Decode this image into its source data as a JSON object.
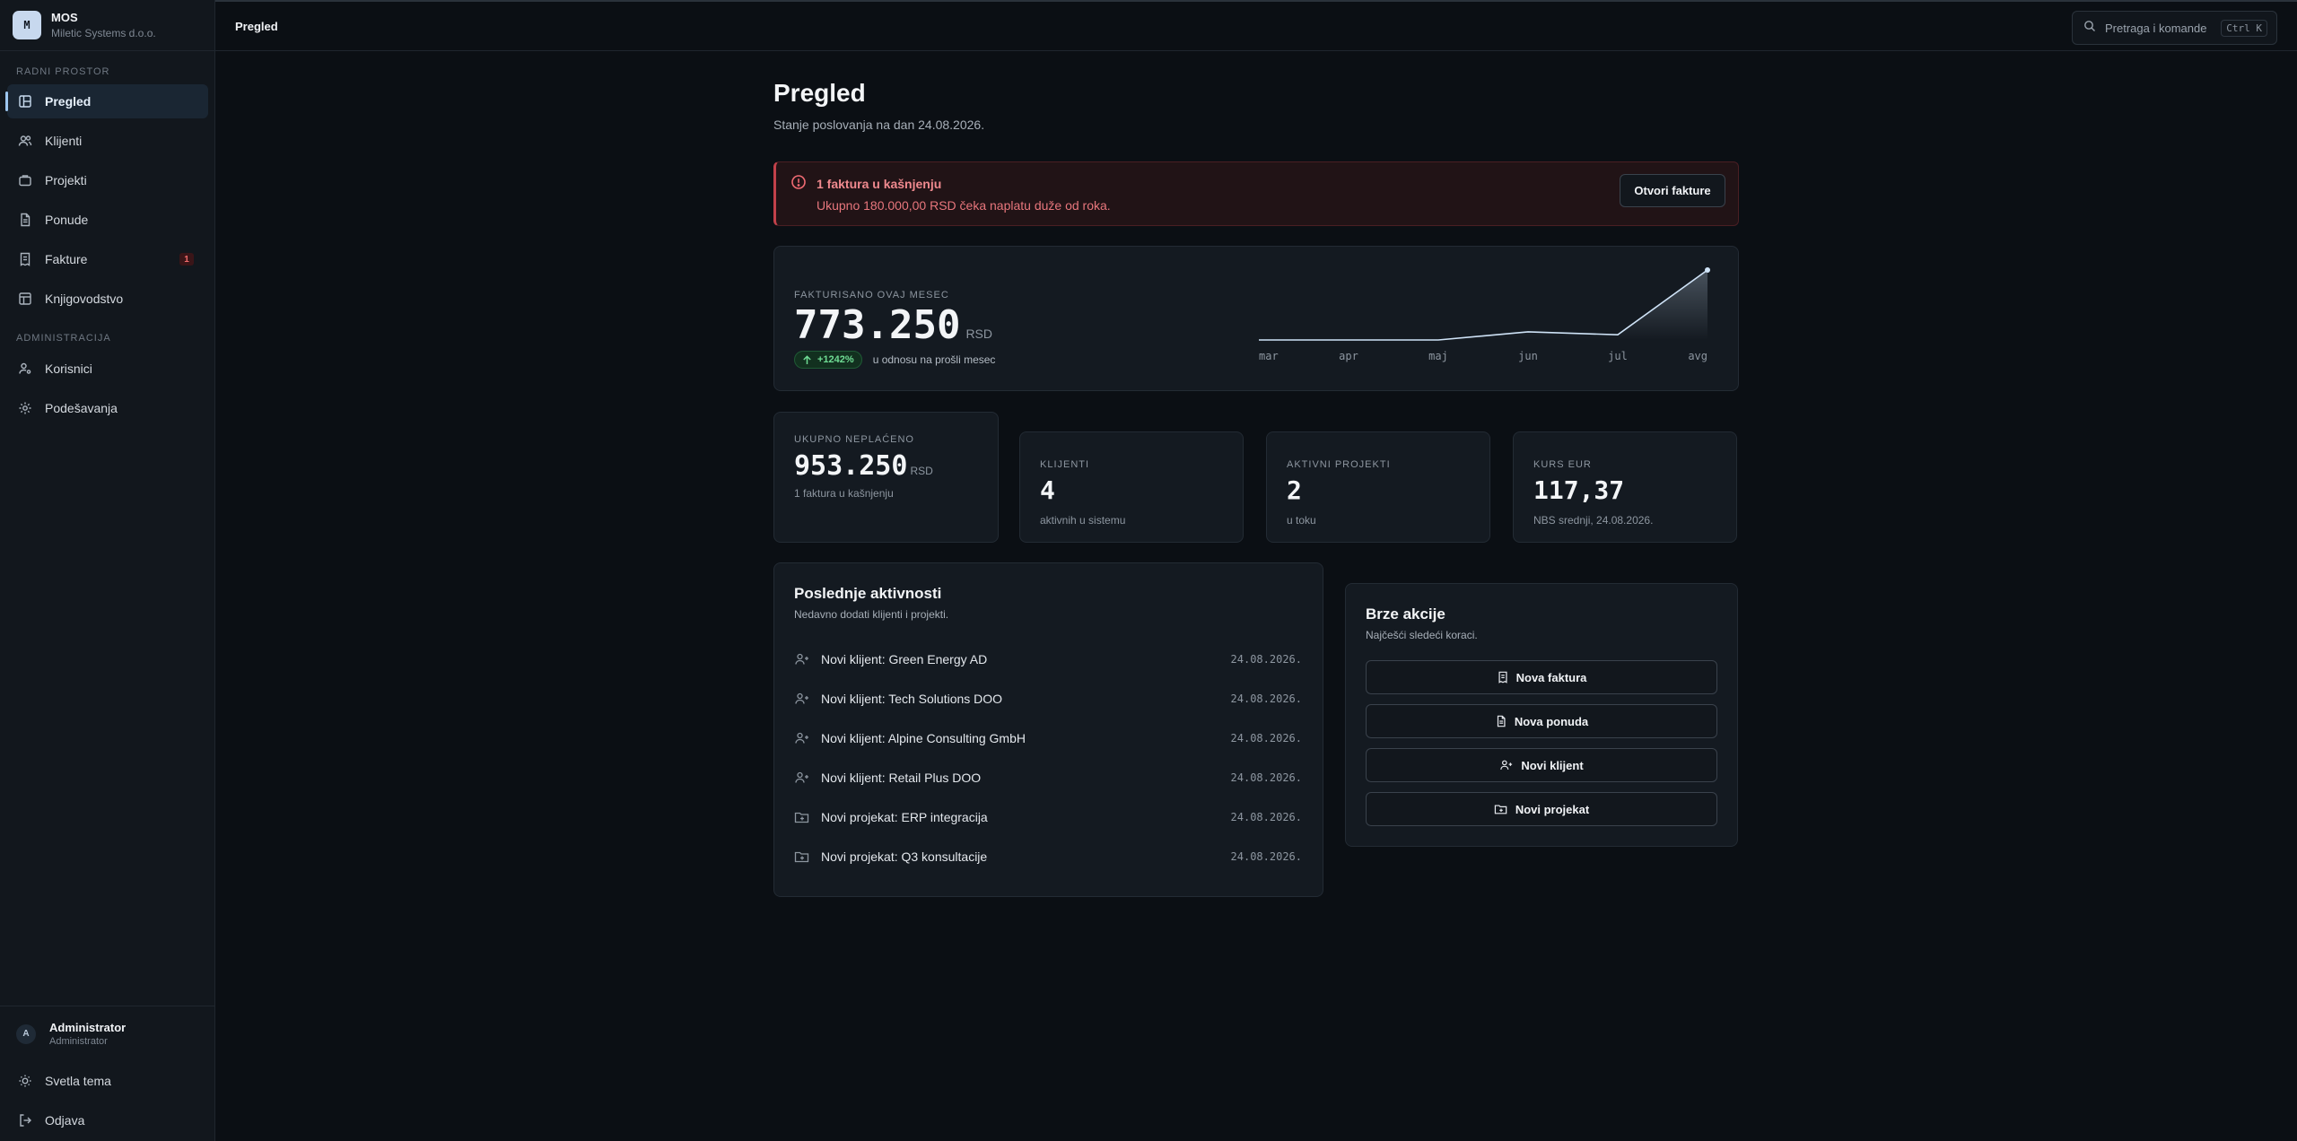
{
  "app": {
    "logo_letter": "M",
    "name": "MOS",
    "company": "Miletic Systems d.o.o."
  },
  "sidebar": {
    "section_workspace": "RADNI PROSTOR",
    "section_admin": "ADMINISTRACIJA",
    "items": [
      {
        "label": "Pregled",
        "icon": "dashboard-icon",
        "active": true
      },
      {
        "label": "Klijenti",
        "icon": "users-icon"
      },
      {
        "label": "Projekti",
        "icon": "briefcase-icon"
      },
      {
        "label": "Ponude",
        "icon": "document-icon"
      },
      {
        "label": "Fakture",
        "icon": "receipt-icon",
        "badge": "1"
      },
      {
        "label": "Knjigovodstvo",
        "icon": "table-icon"
      },
      {
        "label": "Korisnici",
        "icon": "user-cog-icon"
      },
      {
        "label": "Podešavanja",
        "icon": "gear-icon"
      }
    ],
    "footer": {
      "avatar": "A",
      "user_name": "Administrator",
      "user_role": "Administrator",
      "theme_label": "Svetla tema",
      "logout_label": "Odjava"
    }
  },
  "topbar": {
    "title": "Pregled",
    "search_placeholder": "Pretraga i komande",
    "shortcut": "Ctrl K"
  },
  "page": {
    "title": "Pregled",
    "subtitle": "Stanje poslovanja na dan 24.08.2026."
  },
  "alert": {
    "title": "1 faktura u kašnjenju",
    "text": "Ukupno 180.000,00 RSD čeka naplatu duže od roka.",
    "button": "Otvori fakture",
    "color": "#c2414a"
  },
  "billing": {
    "label": "FAKTURISANO OVAJ MESEC",
    "value": "773.250",
    "unit": "RSD",
    "trend": "+1242%",
    "trend_note": "u odnosu na prošli mesec"
  },
  "chart_data": {
    "type": "area",
    "x": [
      "mar",
      "apr",
      "maj",
      "jun",
      "jul",
      "avg"
    ],
    "values": [
      0,
      0,
      0,
      90000,
      57600,
      773250
    ],
    "ylim": [
      0,
      773250
    ],
    "grid": false,
    "legend": "none"
  },
  "kpis": [
    {
      "label": "UKUPNO NEPLAĆENO",
      "value": "953.250",
      "unit": "RSD",
      "sub": "1 faktura u kašnjenju"
    },
    {
      "label": "KLIJENTI",
      "value": "4",
      "sub": "aktivnih u sistemu"
    },
    {
      "label": "AKTIVNI PROJEKTI",
      "value": "2",
      "sub": "u toku"
    },
    {
      "label": "KURS EUR",
      "value": "117,37",
      "sub": "NBS srednji, 24.08.2026."
    }
  ],
  "activity": {
    "title": "Poslednje aktivnosti",
    "subtitle": "Nedavno dodati klijenti i projekti.",
    "items": [
      {
        "text": "Novi klijent: Green Energy AD",
        "date": "24.08.2026.",
        "icon": "user-plus-icon"
      },
      {
        "text": "Novi klijent: Tech Solutions DOO",
        "date": "24.08.2026.",
        "icon": "user-plus-icon"
      },
      {
        "text": "Novi klijent: Alpine Consulting GmbH",
        "date": "24.08.2026.",
        "icon": "user-plus-icon"
      },
      {
        "text": "Novi klijent: Retail Plus DOO",
        "date": "24.08.2026.",
        "icon": "user-plus-icon"
      },
      {
        "text": "Novi projekat: ERP integracija",
        "date": "24.08.2026.",
        "icon": "folder-plus-icon"
      },
      {
        "text": "Novi projekat: Q3 konsultacije",
        "date": "24.08.2026.",
        "icon": "folder-plus-icon"
      }
    ]
  },
  "quick": {
    "title": "Brze akcije",
    "subtitle": "Najčešći sledeći koraci.",
    "actions": [
      {
        "label": "Nova faktura",
        "icon": "receipt-icon"
      },
      {
        "label": "Nova ponuda",
        "icon": "document-icon"
      },
      {
        "label": "Novi klijent",
        "icon": "user-plus-icon"
      },
      {
        "label": "Novi projekat",
        "icon": "folder-plus-icon"
      }
    ]
  }
}
